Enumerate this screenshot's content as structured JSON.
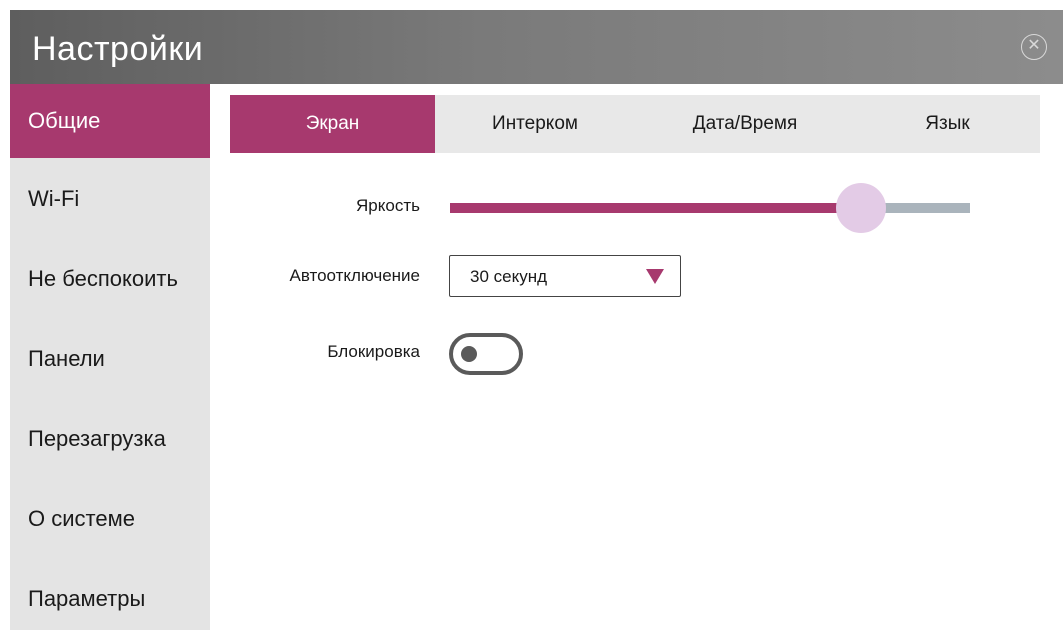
{
  "window": {
    "title": "Настройки",
    "close_icon": "close-circle-icon"
  },
  "sidebar": {
    "items": [
      {
        "label": "Общие",
        "active": true
      },
      {
        "label": "Wi-Fi",
        "active": false
      },
      {
        "label": "Не беспокоить",
        "active": false
      },
      {
        "label": "Панели",
        "active": false
      },
      {
        "label": "Перезагрузка",
        "active": false
      },
      {
        "label": "О системе",
        "active": false
      },
      {
        "label": "Параметры",
        "active": false
      }
    ]
  },
  "tabs": [
    {
      "label": "Экран",
      "active": true
    },
    {
      "label": "Интерком",
      "active": false
    },
    {
      "label": "Дата/Время",
      "active": false
    },
    {
      "label": "Язык",
      "active": false
    }
  ],
  "settings": {
    "brightness": {
      "label": "Яркость",
      "value_fraction": 0.79
    },
    "auto_off": {
      "label": "Автоотключение",
      "value": "30 секунд"
    },
    "lock": {
      "label": "Блокировка",
      "enabled": false
    }
  },
  "colors": {
    "accent": "#a7396e",
    "slider_thumb": "#e3cbe6",
    "slider_track": "#aab4bc",
    "sidebar_bg": "#e4e4e4",
    "tabbar_bg": "#e8e8e8"
  }
}
